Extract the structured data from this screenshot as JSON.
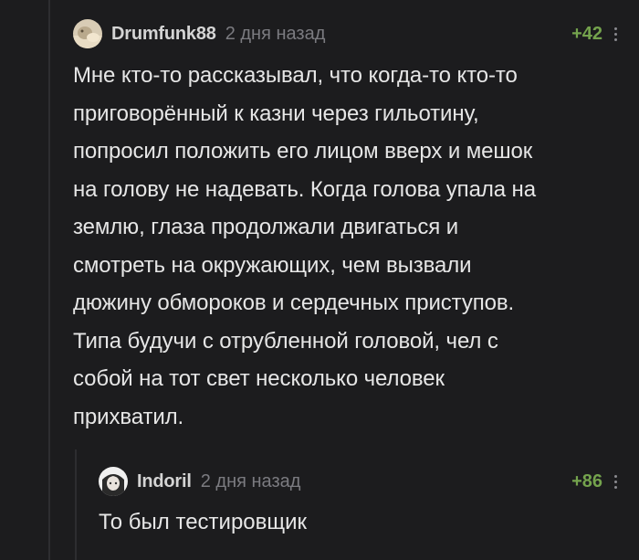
{
  "comments": {
    "main": {
      "username": "Drumfunk88",
      "time": "2 дня назад",
      "rating": "+42",
      "avatar_icon": "user-avatar-icon",
      "text": "Мне кто-то рассказывал, что когда-то кто-то\nприговорённый к казни через гильотину,\nпопросил положить его лицом вверх и мешок\nна голову не надевать. Когда голова упала на\nземлю, глаза продолжали двигаться и\nсмотреть на окружающих, чем вызвали\nдюжину обмороков и сердечных приступов.\nТипа будучи с отрубленной головой, чел с\nсобой на тот свет несколько человек\nприхватил."
    },
    "reply": {
      "username": "Indoril",
      "time": "2 дня назад",
      "rating": "+86",
      "avatar_icon": "user-avatar-icon",
      "text": "То был тестировщик"
    }
  },
  "colors": {
    "background": "#1c1c1e",
    "rating": "#74a34d",
    "muted": "#7b7b80"
  },
  "icons": {
    "more": "more-vertical-icon"
  }
}
